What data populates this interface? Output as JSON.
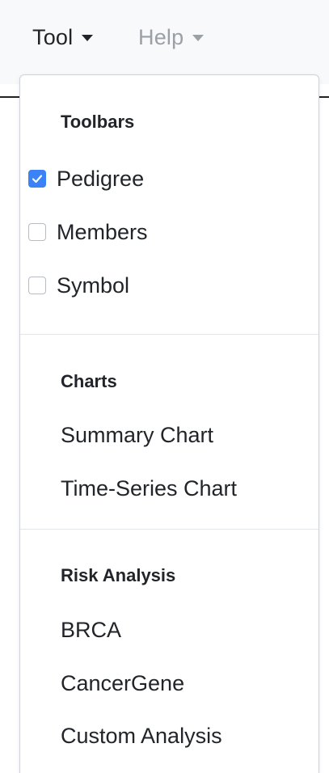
{
  "menubar": {
    "tool_label": "Tool",
    "help_label": "Help"
  },
  "dropdown": {
    "toolbars_header": "Toolbars",
    "toolbars": [
      {
        "label": "Pedigree",
        "checked": true
      },
      {
        "label": "Members",
        "checked": false
      },
      {
        "label": "Symbol",
        "checked": false
      }
    ],
    "charts_header": "Charts",
    "charts": [
      "Summary Chart",
      "Time-Series Chart"
    ],
    "risk_header": "Risk Analysis",
    "risk": [
      "BRCA",
      "CancerGene",
      "Custom Analysis"
    ]
  },
  "colors": {
    "accent": "#3b82f6",
    "menubar_bg": "#f8f9fa",
    "disabled_text": "#9aa0a6"
  }
}
